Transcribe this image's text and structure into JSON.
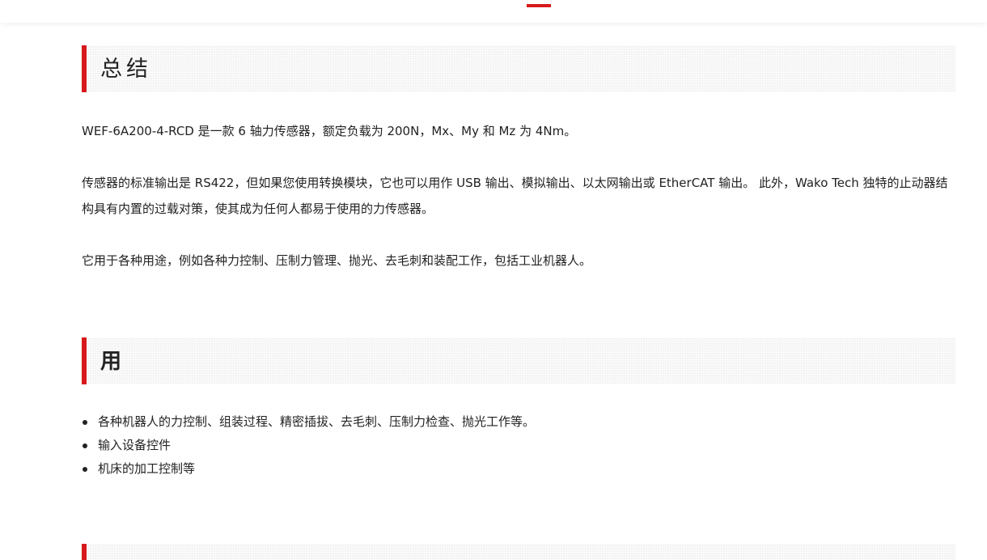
{
  "sections": {
    "summary": {
      "title": "总结",
      "paragraphs": [
        "WEF-6A200-4-RCD 是一款 6 轴力传感器，额定负载为 200N，Mx、My 和 Mz 为 4Nm。",
        "传感器的标准输出是 RS422，但如果您使用转换模块，它也可以用作 USB 输出、模拟输出、以太网输出或 EtherCAT 输出。 此外，Wako Tech 独特的止动器结构具有内置的过载对策，使其成为任何人都易于使用的力传感器。",
        "它用于各种用途，例如各种力控制、压制力管理、抛光、去毛刺和装配工作，包括工业机器人。"
      ]
    },
    "uses": {
      "title": "用",
      "items": [
        "各种机器人的力控制、组装过程、精密插拔、去毛刺、压制力检查、抛光工作等。",
        "输入设备控件",
        "机床的加工控制等"
      ]
    }
  },
  "colors": {
    "accent": "#d7191c",
    "heading_bg": "#f3f3f3",
    "text": "#222222"
  }
}
